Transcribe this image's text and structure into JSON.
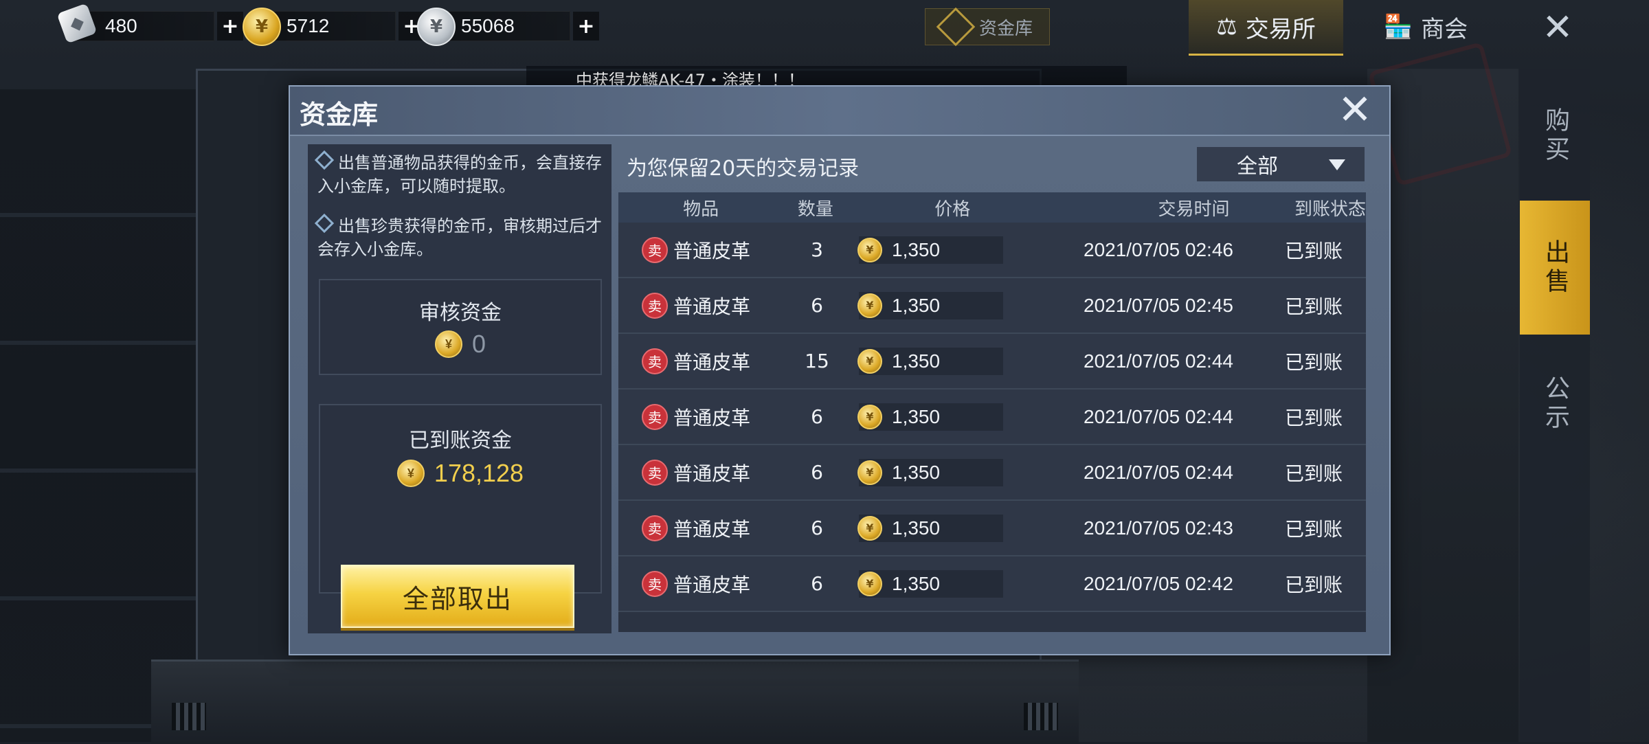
{
  "currencies": [
    {
      "icon": "diamond-ticket-icon",
      "value": "480",
      "plus": "+"
    },
    {
      "icon": "gold-coin-icon",
      "value": "5712",
      "plus": "+"
    },
    {
      "icon": "silver-coin-icon",
      "value": "55068",
      "plus": "+"
    }
  ],
  "top_nav": {
    "vault_tab": "资金库",
    "exchange": "交易所",
    "shop": "商会",
    "close": "✕"
  },
  "marquee": "中获得龙鳞AK-47・涂装！！！",
  "side_tabs": [
    "购买",
    "出售",
    "公示"
  ],
  "side_tab_active": "出售",
  "modal": {
    "title": "资金库",
    "close": "✕",
    "notes": [
      "出售普通物品获得的金币，会直接存入小金库，可以随时提取。",
      "出售珍贵获得的金币，审核期过后才会存入小金库。"
    ],
    "review_funds": {
      "label": "审核资金",
      "amount": "0"
    },
    "arrived_funds": {
      "label": "已到账资金",
      "amount": "178,128"
    },
    "withdraw_button": "全部取出",
    "retention_text": "为您保留20天的交易记录",
    "filter_value": "全部",
    "table": {
      "headers": [
        "物品",
        "数量",
        "价格",
        "交易时间",
        "到账状态"
      ],
      "rows": [
        {
          "type": "卖",
          "item": "普通皮革",
          "qty": "3",
          "price": "1,350",
          "time": "2021/07/05  02:46",
          "status": "已到账"
        },
        {
          "type": "卖",
          "item": "普通皮革",
          "qty": "6",
          "price": "1,350",
          "time": "2021/07/05  02:45",
          "status": "已到账"
        },
        {
          "type": "卖",
          "item": "普通皮革",
          "qty": "15",
          "price": "1,350",
          "time": "2021/07/05  02:44",
          "status": "已到账"
        },
        {
          "type": "卖",
          "item": "普通皮革",
          "qty": "6",
          "price": "1,350",
          "time": "2021/07/05  02:44",
          "status": "已到账"
        },
        {
          "type": "卖",
          "item": "普通皮革",
          "qty": "6",
          "price": "1,350",
          "time": "2021/07/05  02:44",
          "status": "已到账"
        },
        {
          "type": "卖",
          "item": "普通皮革",
          "qty": "6",
          "price": "1,350",
          "time": "2021/07/05  02:43",
          "status": "已到账"
        },
        {
          "type": "卖",
          "item": "普通皮革",
          "qty": "6",
          "price": "1,350",
          "time": "2021/07/05  02:42",
          "status": "已到账"
        }
      ]
    }
  },
  "colors": {
    "accent_gold": "#e7b733",
    "sell_red": "#c9323a",
    "modal_bg": "#5b6b82"
  }
}
